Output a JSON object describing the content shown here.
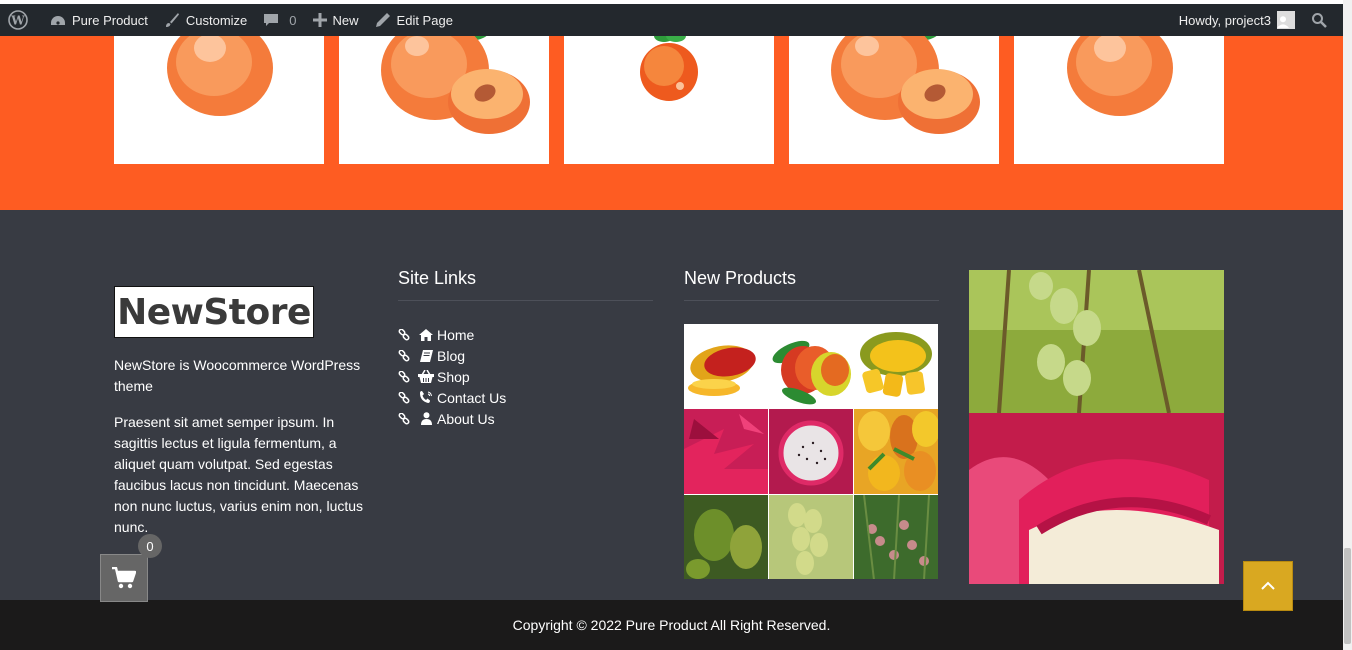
{
  "adminbar": {
    "site_name": "Pure Product",
    "customize": "Customize",
    "comments_count": "0",
    "new": "New",
    "edit_page": "Edit Page",
    "howdy": "Howdy, project3"
  },
  "footer": {
    "logo_text": "NewStore",
    "about_tagline": "NewStore is Woocommerce WordPress theme",
    "about_text": "Praesent sit amet semper ipsum. In sagittis lectus et ligula fermentum, a aliquet quam volutpat. Sed egestas faucibus lacus non tincidunt. Maecenas non nunc luctus, varius enim non, luctus nunc.",
    "site_links_title": "Site Links",
    "site_links": [
      {
        "label": "Home",
        "icon": "home-icon"
      },
      {
        "label": "Blog",
        "icon": "book-icon"
      },
      {
        "label": "Shop",
        "icon": "basket-icon"
      },
      {
        "label": "Contact Us",
        "icon": "phone-icon"
      },
      {
        "label": "About Us",
        "icon": "user-icon"
      }
    ],
    "new_products_title": "New Products"
  },
  "cart": {
    "count": "0"
  },
  "copyright": "Copyright © 2022 Pure Product All Right Reserved.",
  "colors": {
    "adminbar": "#23282d",
    "accent_orange": "#fe5c22",
    "footer_bg": "#383b43",
    "copyright_bg": "#1b1a1a",
    "to_top": "#d9a821"
  }
}
